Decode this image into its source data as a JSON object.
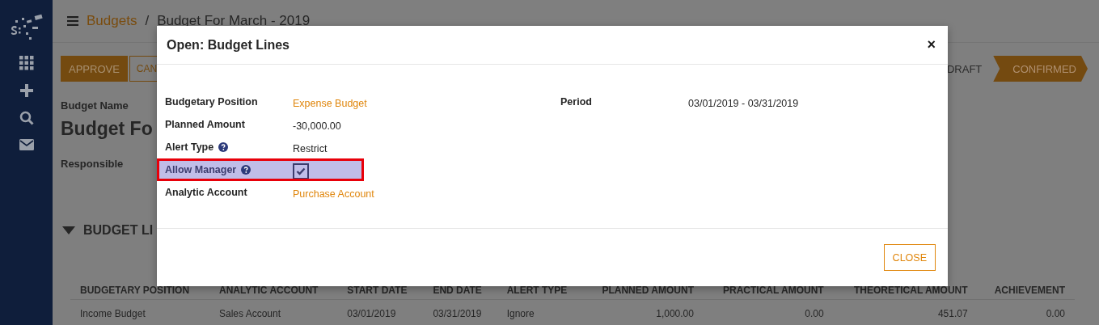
{
  "breadcrumb": {
    "parent": "Budgets",
    "separator": "/",
    "current": "Budget For March - 2019"
  },
  "actions": [
    {
      "label": "APPROVE",
      "primary": true
    },
    {
      "label": "CAN",
      "primary": false
    }
  ],
  "status": [
    {
      "label": "DRAFT",
      "selected": false
    },
    {
      "label": "CONFIRMED",
      "selected": true
    }
  ],
  "form": {
    "name_label": "Budget Name",
    "name": "Budget Fo",
    "responsible_label": "Responsible"
  },
  "section": {
    "title": "BUDGET LI",
    "expanded": true
  },
  "table": {
    "columns": [
      "BUDGETARY POSITION",
      "ANALYTIC ACCOUNT",
      "START DATE",
      "END DATE",
      "ALERT TYPE",
      "PLANNED AMOUNT",
      "PRACTICAL AMOUNT",
      "THEORETICAL AMOUNT",
      "ACHIEVEMENT"
    ],
    "rows": [
      [
        "Income Budget",
        "Sales Account",
        "03/01/2019",
        "03/31/2019",
        "Ignore",
        "1,000.00",
        "0.00",
        "451.07",
        "0.00"
      ]
    ]
  },
  "dialog": {
    "title": "Open: Budget Lines",
    "close_glyph": "×",
    "fields": [
      {
        "label": "Budgetary Position",
        "kind": "link",
        "value": "Expense Budget",
        "help": false,
        "highlighted": false
      },
      {
        "label": "Planned Amount",
        "kind": "text",
        "value": "-30,000.00",
        "help": false,
        "highlighted": false
      },
      {
        "label": "Alert Type",
        "kind": "text",
        "value": "Restrict",
        "help": true,
        "highlighted": false
      },
      {
        "label": "Allow Manager",
        "kind": "checkbox",
        "checked": true,
        "help": true,
        "highlighted": true
      },
      {
        "label": "Analytic Account",
        "kind": "link",
        "value": "Purchase Account",
        "help": false,
        "highlighted": false
      }
    ],
    "right_fields": [
      {
        "label": "Period",
        "kind": "text",
        "value": "03/01/2019 - 03/31/2019"
      }
    ],
    "buttons": [
      "CLOSE"
    ]
  }
}
